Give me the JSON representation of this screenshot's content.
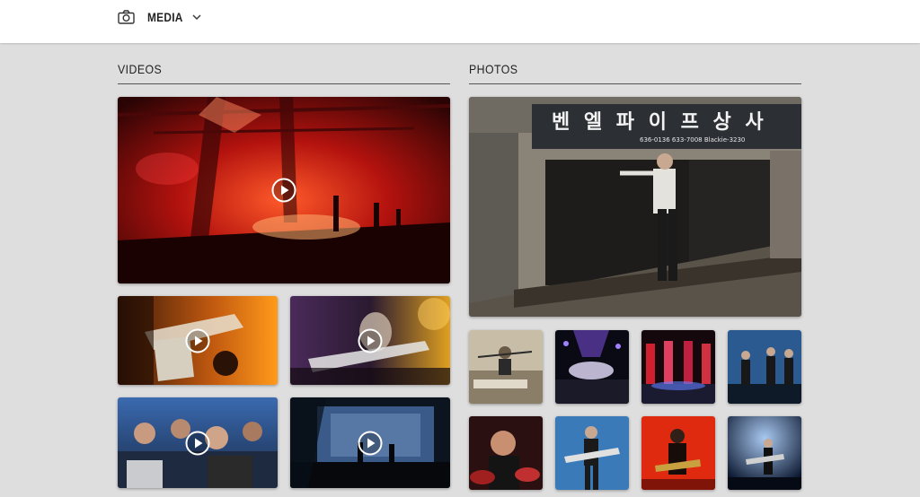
{
  "header": {
    "media_label": "MEDIA",
    "camera_icon": "camera-icon",
    "dropdown_icon": "chevron-down-icon"
  },
  "videos": {
    "title": "VIDEOS",
    "items": [
      {
        "scene": "red stage concert wide shot"
      },
      {
        "scene": "guitar close-up orange light"
      },
      {
        "scene": "guitarist with purple lights"
      },
      {
        "scene": "crowd in blue light"
      },
      {
        "scene": "stage with giant blue screen"
      }
    ]
  },
  "photos": {
    "title": "PHOTOS",
    "sign_text": "벤 엘 파 이 프 상 사",
    "sign_numbers": "636-0136  633-7008 Blackie-3230",
    "items": [
      {
        "scene": "singer in front of Korean pipe store"
      },
      {
        "scene": "drummer in studio"
      },
      {
        "scene": "arena with purple lights"
      },
      {
        "scene": "stage with red lights"
      },
      {
        "scene": "band on blue stage"
      },
      {
        "scene": "drummer closeup"
      },
      {
        "scene": "guitarist in blue"
      },
      {
        "scene": "guitarist red background"
      },
      {
        "scene": "guitarist blue spotlight"
      }
    ]
  }
}
